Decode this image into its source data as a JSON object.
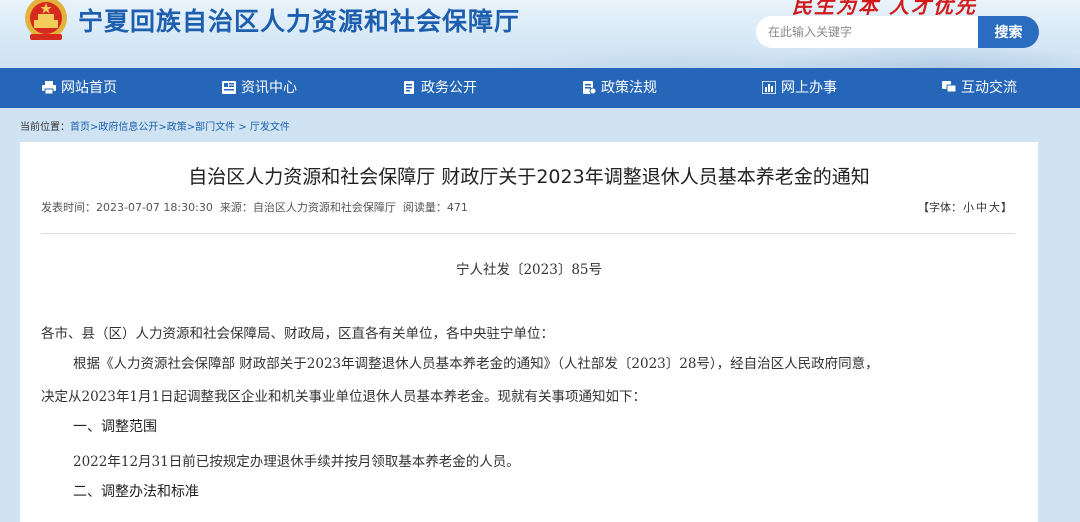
{
  "header": {
    "site_title": "宁夏回族自治区人力资源和社会保障厅",
    "slogan": "民生为本 人才优先",
    "search_placeholder": "在此输入关键字",
    "search_button": "搜索"
  },
  "nav": {
    "items": [
      {
        "label": "网站首页",
        "icon": "printer-icon"
      },
      {
        "label": "资讯中心",
        "icon": "news-icon"
      },
      {
        "label": "政务公开",
        "icon": "document-icon"
      },
      {
        "label": "政策法规",
        "icon": "policy-icon"
      },
      {
        "label": "网上办事",
        "icon": "chart-icon"
      },
      {
        "label": "互动交流",
        "icon": "chat-icon"
      }
    ]
  },
  "breadcrumb": {
    "prefix": "当前位置：",
    "items": [
      "首页",
      "政府信息公开",
      "政策",
      "部门文件",
      "厅发文件"
    ],
    "separators": [
      ">",
      ">",
      ">",
      " > "
    ]
  },
  "article": {
    "title": "自治区人力资源和社会保障厅 财政厅关于2023年调整退休人员基本养老金的通知",
    "published": "发表时间：2023-07-07 18:30:30",
    "source": "来源：自治区人力资源和社会保障厅",
    "views": "阅读量：471",
    "font_size_label_open": "【字体：",
    "font_small": "小",
    "font_medium": "中",
    "font_large": "大",
    "font_size_label_close": "】",
    "doc_number": "宁人社发〔2023〕85号",
    "salutation": "各市、县（区）人力资源和社会保障局、财政局，区直各有关单位，各中央驻宁单位：",
    "para1_line1": "根据《人力资源社会保障部 财政部关于2023年调整退休人员基本养老金的通知》（人社部发〔2023〕28号），经自治区人民政府同意，",
    "para1_line2": "决定从2023年1月1日起调整我区企业和机关事业单位退休人员基本养老金。现就有关事项通知如下：",
    "heading1": "一、调整范围",
    "para2": "2022年12月31日前已按规定办理退休手续并按月领取基本养老金的人员。",
    "heading2": "二、调整办法和标准"
  },
  "colors": {
    "nav_bg": "#2566b8",
    "title_blue": "#1d5fae",
    "slogan_red": "#d21a1a"
  }
}
